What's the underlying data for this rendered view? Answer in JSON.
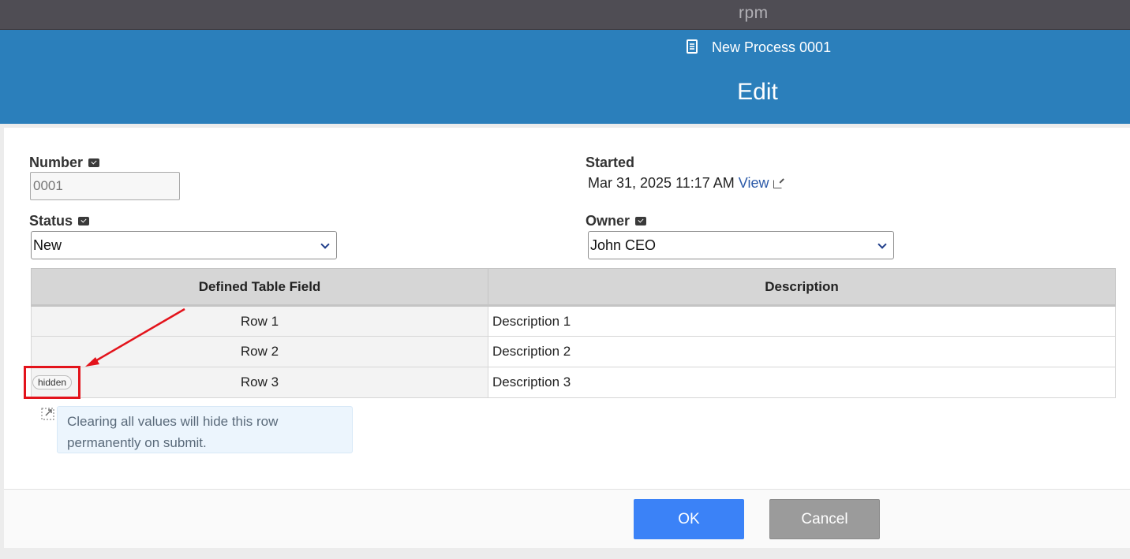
{
  "app": {
    "brand": "rpm"
  },
  "header": {
    "process_title": "New Process 0001",
    "mode": "Edit"
  },
  "form": {
    "number": {
      "label": "Number",
      "value": "0001"
    },
    "started": {
      "label": "Started",
      "value": "Mar 31, 2025 11:17 AM",
      "link": "View"
    },
    "status": {
      "label": "Status",
      "selected": "New"
    },
    "owner": {
      "label": "Owner",
      "selected": "John CEO"
    }
  },
  "table": {
    "columns": [
      "Defined Table Field",
      "Description"
    ],
    "rows": [
      {
        "field": "Row 1",
        "description": "Description 1"
      },
      {
        "field": "Row 2",
        "description": "Description 2"
      },
      {
        "field": "Row 3",
        "description": "Description 3",
        "badge": "hidden"
      }
    ]
  },
  "tip": {
    "text": "Clearing all values will hide this row permanently on submit."
  },
  "footer": {
    "ok_label": "OK",
    "cancel_label": "Cancel"
  },
  "colors": {
    "header": "#2b7fbb",
    "topbar": "#4f4d54",
    "ok": "#3b82f7",
    "cancel": "#9b9b9b",
    "annotation": "#e3131b"
  }
}
